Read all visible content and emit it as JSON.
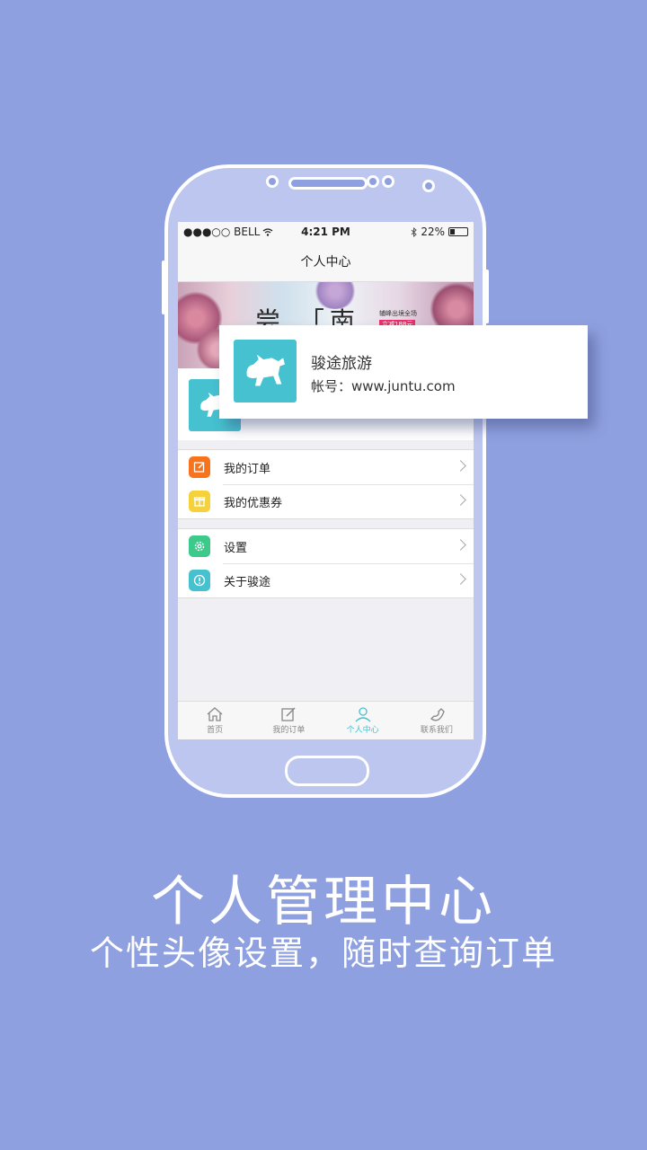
{
  "status_bar": {
    "carrier": "●●●○○ BELL",
    "time": "4:21 PM",
    "battery": "22%"
  },
  "nav": {
    "title": "个人中心"
  },
  "banner": {
    "big_text": "尝 「南",
    "tag_line1": "辅峰出境全场",
    "tag_line2": "立减188元"
  },
  "profile": {
    "name": "骏途旅游",
    "account": "帐号：www.juntu.com"
  },
  "menu_groups": [
    [
      {
        "label": "我的订单",
        "icon": "edit-icon",
        "color": "#f7741c"
      },
      {
        "label": "我的优惠券",
        "icon": "gift-icon",
        "color": "#f5d23b"
      }
    ],
    [
      {
        "label": "设置",
        "icon": "gear-icon",
        "color": "#3cc98a"
      },
      {
        "label": "关于骏途",
        "icon": "info-icon",
        "color": "#45c1cf"
      }
    ]
  ],
  "tabs": [
    {
      "label": "首页",
      "icon": "home-icon"
    },
    {
      "label": "我的订单",
      "icon": "pencil-icon"
    },
    {
      "label": "个人中心",
      "icon": "user-icon",
      "active": true
    },
    {
      "label": "联系我们",
      "icon": "phone-icon"
    }
  ],
  "headline": "个人管理中心",
  "subline": "个性头像设置，随时查询订单",
  "colors": {
    "background": "#8fa0e0",
    "accent": "#45c1cf",
    "phone_body": "#bcc6ee"
  }
}
